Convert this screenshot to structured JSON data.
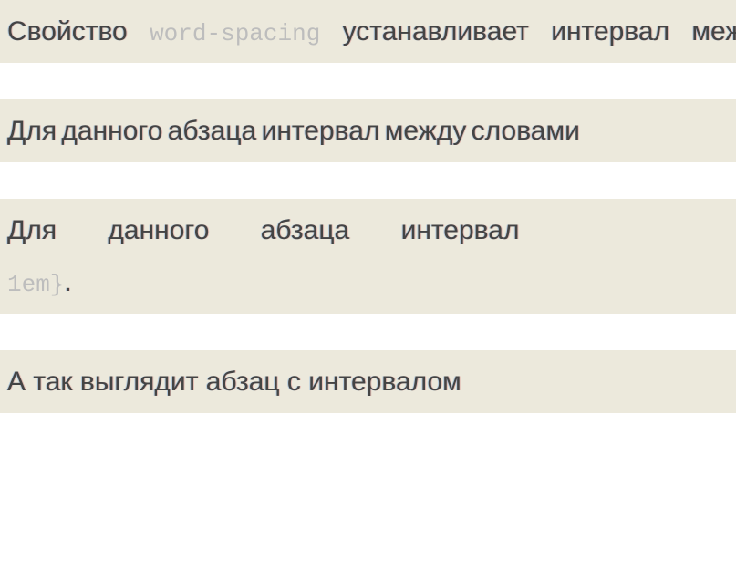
{
  "paragraphs": {
    "p1": {
      "t1": "Свойство ",
      "code": "word-spacing",
      "t2": " устанавливает интервал между словами. В данном примере интервал между словами "
    },
    "p2": {
      "text": "Для данного абзаца интервал между словами "
    },
    "p3": {
      "t1": "Для данного абзаца интервал ",
      "code": "1em}",
      "t2": "."
    },
    "p4": {
      "text": "А так выглядит абзац с интервалом "
    }
  }
}
